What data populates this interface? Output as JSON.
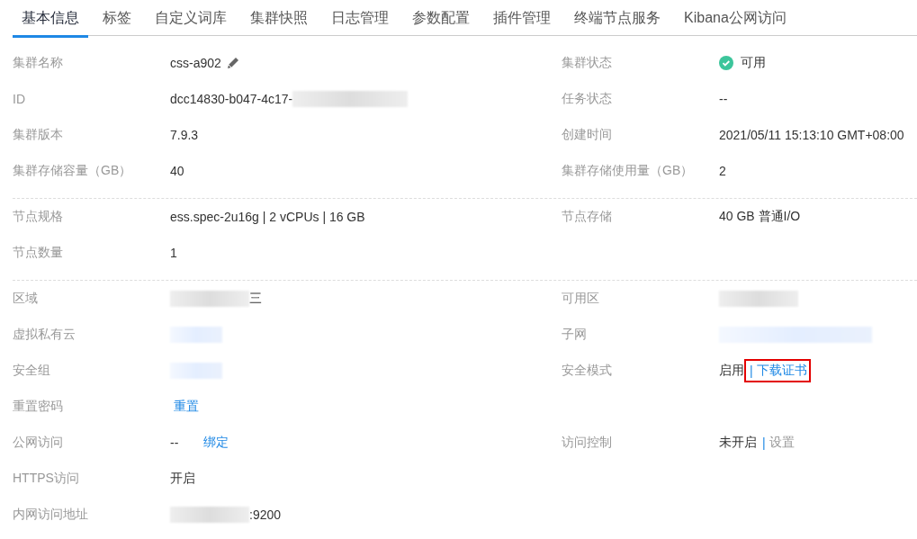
{
  "tabs": [
    {
      "label": "基本信息",
      "selected": true
    },
    {
      "label": "标签",
      "selected": false
    },
    {
      "label": "自定义词库",
      "selected": false
    },
    {
      "label": "集群快照",
      "selected": false
    },
    {
      "label": "日志管理",
      "selected": false
    },
    {
      "label": "参数配置",
      "selected": false
    },
    {
      "label": "插件管理",
      "selected": false
    },
    {
      "label": "终端节点服务",
      "selected": false
    },
    {
      "label": "Kibana公网访问",
      "selected": false
    }
  ],
  "sections": [
    {
      "rows": [
        {
          "left": {
            "label": "集群名称",
            "value": [
              {
                "kind": "text",
                "text": "css-a902"
              },
              {
                "kind": "edit"
              }
            ]
          },
          "right": {
            "label": "集群状态",
            "value": [
              {
                "kind": "status",
                "text": "可用"
              }
            ]
          }
        },
        {
          "left": {
            "label": "ID",
            "value": [
              {
                "kind": "text",
                "text": "dcc14830-b047-4c17-"
              },
              {
                "kind": "blur"
              }
            ]
          },
          "right": {
            "label": "任务状态",
            "value": [
              {
                "kind": "text",
                "text": "--"
              }
            ]
          }
        },
        {
          "left": {
            "label": "集群版本",
            "value": [
              {
                "kind": "text",
                "text": "7.9.3"
              }
            ]
          },
          "right": {
            "label": "创建时间",
            "value": [
              {
                "kind": "text",
                "text": "2021/05/11 15:13:10 GMT+08:00"
              }
            ]
          }
        },
        {
          "left": {
            "label": "集群存储容量（GB）",
            "value": [
              {
                "kind": "text",
                "text": "40"
              }
            ]
          },
          "right": {
            "label": "集群存储使用量（GB）",
            "value": [
              {
                "kind": "text",
                "text": "2"
              }
            ]
          }
        }
      ]
    },
    {
      "rows": [
        {
          "left": {
            "label": "节点规格",
            "value": [
              {
                "kind": "text",
                "text": "ess.spec-2u16g | 2 vCPUs | 16 GB"
              }
            ]
          },
          "right": {
            "label": "节点存储",
            "value": [
              {
                "kind": "text",
                "text": "40 GB 普通I/O"
              }
            ]
          }
        },
        {
          "left": {
            "label": "节点数量",
            "value": [
              {
                "kind": "text",
                "text": "1"
              }
            ]
          }
        }
      ]
    },
    {
      "rows": [
        {
          "left": {
            "label": "区域",
            "value": [
              {
                "kind": "blur"
              },
              {
                "kind": "text",
                "text": "三"
              }
            ]
          },
          "right": {
            "label": "可用区",
            "value": [
              {
                "kind": "blur"
              }
            ]
          }
        },
        {
          "left": {
            "label": "虚拟私有云",
            "value": [
              {
                "kind": "blur_link"
              }
            ]
          },
          "right": {
            "label": "子网",
            "value": [
              {
                "kind": "blur_link"
              }
            ]
          }
        },
        {
          "left": {
            "label": "安全组",
            "value": [
              {
                "kind": "blur_link"
              }
            ]
          },
          "right": {
            "label": "安全模式",
            "value": [
              {
                "kind": "text",
                "text": "启用"
              },
              {
                "kind": "link",
                "separator": "|",
                "text": "下载证书",
                "highlighted": true,
                "disabled": false
              }
            ]
          }
        },
        {
          "left": {
            "label": "重置密码",
            "value": [
              {
                "kind": "link",
                "text": "重置",
                "disabled": false
              }
            ]
          }
        },
        {
          "left": {
            "label": "公网访问",
            "value": [
              {
                "kind": "text",
                "text": "--"
              },
              {
                "kind": "link",
                "text": "绑定",
                "disabled": false
              }
            ]
          },
          "right": {
            "label": "访问控制",
            "value": [
              {
                "kind": "text",
                "text": "未开启"
              },
              {
                "kind": "link",
                "separator": "|",
                "text": "设置",
                "disabled": true
              }
            ]
          }
        },
        {
          "left": {
            "label": "HTTPS访问",
            "value": [
              {
                "kind": "text",
                "text": "开启"
              }
            ]
          }
        },
        {
          "left": {
            "label": "内网访问地址",
            "value": [
              {
                "kind": "blur"
              },
              {
                "kind": "text",
                "text": ":9200"
              }
            ]
          }
        }
      ]
    }
  ]
}
